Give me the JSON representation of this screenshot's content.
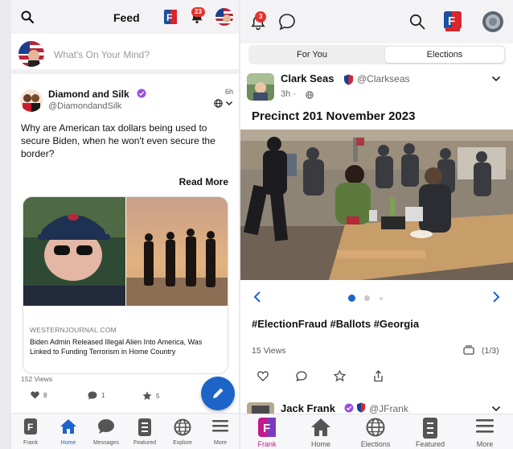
{
  "left_screen": {
    "header": {
      "title": "Feed",
      "notification_count": "23"
    },
    "compose": {
      "placeholder": "What's On Your Mind?"
    },
    "post": {
      "author_name": "Diamond and Silk",
      "author_handle": "@DiamondandSilk",
      "time": "6h",
      "text": "Why are American tax dollars being used to secure Biden, when he won't even secure the border?",
      "read_more": "Read More",
      "link_card": {
        "domain": "WESTERNJOURNAL.COM",
        "title": "Biden Admin Released Illegal Alien Into America, Was Linked to Funding Terrorism in Home Country"
      },
      "views": "152 Views",
      "likes": "8",
      "comments": "1",
      "stars": "5"
    },
    "bottom_nav": [
      {
        "label": "Frank",
        "icon": "frank-app-icon"
      },
      {
        "label": "Home",
        "icon": "home-icon",
        "active": true
      },
      {
        "label": "Messages",
        "icon": "messages-icon"
      },
      {
        "label": "Featured",
        "icon": "featured-icon"
      },
      {
        "label": "Explore",
        "icon": "globe-icon"
      },
      {
        "label": "More",
        "icon": "menu-icon"
      }
    ]
  },
  "right_screen": {
    "header": {
      "notification_count": "3"
    },
    "tabs": [
      {
        "label": "For You",
        "selected": false
      },
      {
        "label": "Elections",
        "selected": true
      }
    ],
    "post": {
      "author_name": "Clark Seas",
      "author_handle": "@Clarkseas",
      "time": "3h ·",
      "headline": "Precinct 201 November 2023",
      "hashtags": "#ElectionFraud #Ballots #Georgia",
      "views": "15 Views",
      "image_count": "(1/3)"
    },
    "next_post": {
      "author_name": "Jack Frank",
      "author_handle": "@JFrank"
    },
    "bottom_nav": [
      {
        "label": "Frank",
        "icon": "frank-app-icon",
        "active": true
      },
      {
        "label": "Home",
        "icon": "home-icon"
      },
      {
        "label": "Elections",
        "icon": "globe-icon"
      },
      {
        "label": "Featured",
        "icon": "featured-icon"
      },
      {
        "label": "More",
        "icon": "menu-icon"
      }
    ]
  },
  "colors": {
    "accent_blue": "#1d64c9",
    "badge_red": "#e5322d",
    "brand_magenta": "#c2188b"
  }
}
